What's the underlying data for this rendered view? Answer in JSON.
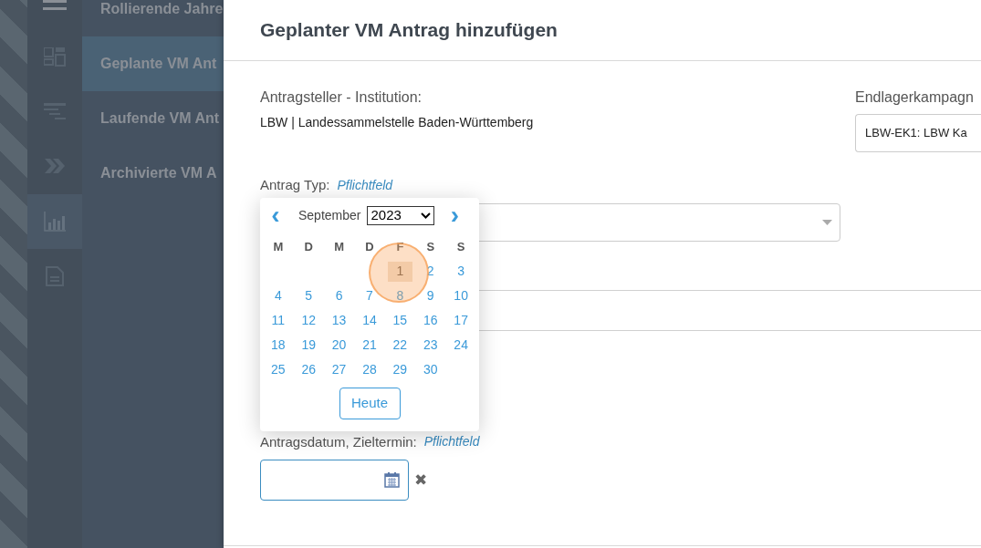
{
  "icon_rail": [
    {
      "kind": "dashboard",
      "selected": false
    },
    {
      "kind": "lines",
      "selected": false
    },
    {
      "kind": "chevrons",
      "selected": false
    },
    {
      "kind": "chart",
      "selected": true
    },
    {
      "kind": "document",
      "selected": false
    }
  ],
  "nav": [
    {
      "label": "Rollierende Jahre",
      "selected": false
    },
    {
      "label": "Geplante VM Ant",
      "selected": true
    },
    {
      "label": "Laufende VM Ant",
      "selected": false
    },
    {
      "label": "Archivierte VM A",
      "selected": false
    }
  ],
  "dialog": {
    "title": "Geplanter VM Antrag hinzufügen",
    "applicant_label": "Antragsteller - Institution:",
    "applicant_value": "LBW | Landessammelstelle Baden-Württemberg",
    "campaign_label": "Endlagerkampagn",
    "campaign_value": "LBW-EK1: LBW Ka",
    "type_label": "Antrag Typ:",
    "type_required": "Pflichtfeld",
    "date_label": "Antragsdatum, Zieltermin:",
    "date_required": "Pflichtfeld"
  },
  "datepicker": {
    "prev": "‹",
    "month": "September",
    "year": "2023",
    "next": "›",
    "weekdays": [
      "M",
      "D",
      "M",
      "D",
      "F",
      "S",
      "S"
    ],
    "days": [
      {
        "kind": "blank"
      },
      {
        "kind": "blank"
      },
      {
        "kind": "blank"
      },
      {
        "kind": "blank"
      },
      {
        "kind": "day",
        "label": "1",
        "hovered": true
      },
      {
        "label": "2",
        "hovered": false
      },
      {
        "label": "3",
        "hovered": false
      },
      {
        "label": "4",
        "hovered": false
      },
      {
        "label": "5",
        "hovered": false
      },
      {
        "label": "6",
        "hovered": false
      },
      {
        "label": "7",
        "hovered": false
      },
      {
        "label": "8",
        "hovered": false
      },
      {
        "label": "9",
        "hovered": false
      },
      {
        "label": "10",
        "hovered": false
      },
      {
        "label": "11",
        "hovered": false
      },
      {
        "label": "12",
        "hovered": false
      },
      {
        "label": "13",
        "hovered": false
      },
      {
        "label": "14",
        "hovered": false
      },
      {
        "label": "15",
        "hovered": false
      },
      {
        "label": "16",
        "hovered": false
      },
      {
        "label": "17",
        "hovered": false
      },
      {
        "label": "18",
        "hovered": false
      },
      {
        "label": "19",
        "hovered": false
      },
      {
        "label": "20",
        "hovered": false
      },
      {
        "label": "21",
        "hovered": false
      },
      {
        "label": "22",
        "hovered": false
      },
      {
        "label": "23",
        "hovered": false
      },
      {
        "label": "24",
        "hovered": false
      },
      {
        "label": "25",
        "hovered": false
      },
      {
        "label": "26",
        "hovered": false
      },
      {
        "label": "27",
        "hovered": false
      },
      {
        "label": "28",
        "hovered": false
      },
      {
        "label": "29",
        "hovered": false
      },
      {
        "label": "30",
        "hovered": false
      }
    ],
    "today_button": "Heute"
  },
  "clear_button": "✖"
}
